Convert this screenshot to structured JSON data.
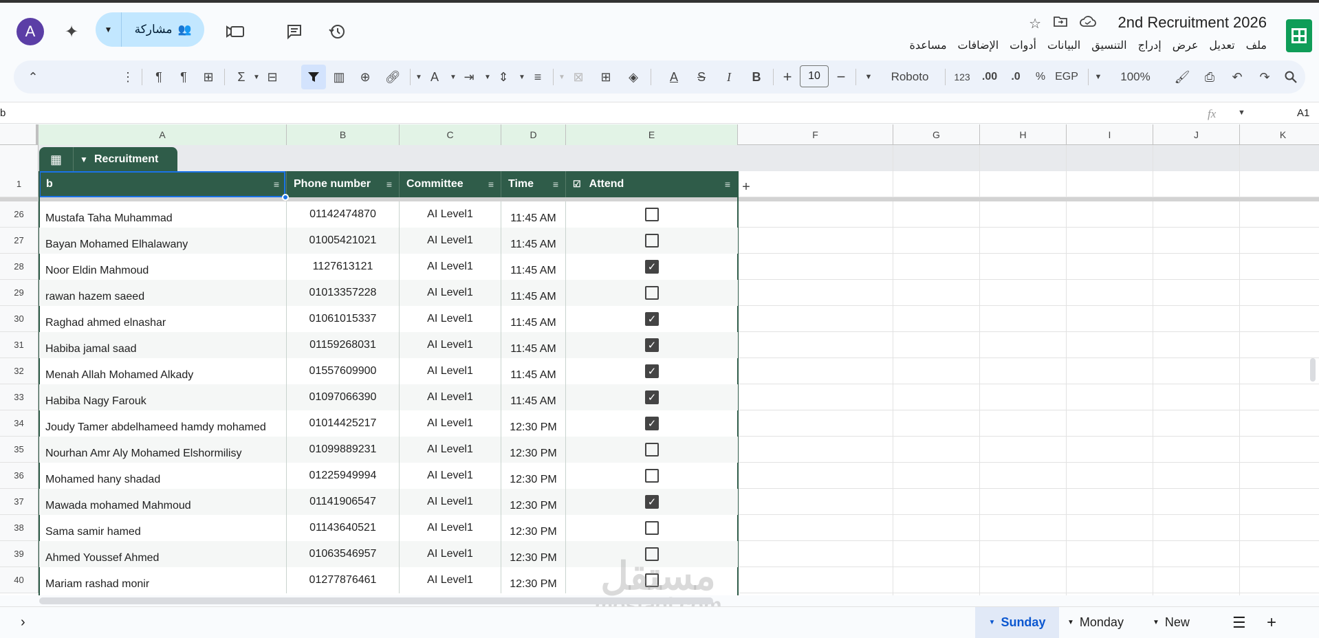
{
  "app": {
    "title": "2nd Recruitment 2026",
    "accent_color": "#2f5c49",
    "account_initial": "A",
    "share_label": "مشاركة"
  },
  "menus": [
    "ملف",
    "تعديل",
    "عرض",
    "إدراج",
    "التنسيق",
    "البيانات",
    "أدوات",
    "الإضافات",
    "مساعدة"
  ],
  "toolbar": {
    "zoom": "100%",
    "currency": "EGP",
    "percent": "%",
    "decrease_decimals": ".0",
    "increase_decimals": ".00",
    "number_format": "123",
    "font": "Roboto",
    "font_size": "10"
  },
  "formula_bar": {
    "cell_ref": "A1",
    "fx": "fx",
    "content": "b"
  },
  "columns": [
    "A",
    "B",
    "C",
    "D",
    "E",
    "F",
    "G",
    "H",
    "I",
    "J",
    "K"
  ],
  "table": {
    "name": "Recruitment",
    "headers": [
      "b",
      "Phone number",
      "Committee",
      "Time",
      "Attend"
    ],
    "header_row_number": "1",
    "rows": [
      {
        "n": "26",
        "name": "Mustafa Taha Muhammad",
        "phone": "01142474870",
        "committee": "AI Level1",
        "time": "11:45 AM",
        "attend": false
      },
      {
        "n": "27",
        "name": "Bayan Mohamed Elhalawany",
        "phone": "01005421021",
        "committee": "AI Level1",
        "time": "11:45 AM",
        "attend": false
      },
      {
        "n": "28",
        "name": "Noor Eldin Mahmoud",
        "phone": "1127613121",
        "committee": "AI Level1",
        "time": "11:45 AM",
        "attend": true
      },
      {
        "n": "29",
        "name": "rawan hazem saeed",
        "phone": "01013357228",
        "committee": "AI Level1",
        "time": "11:45 AM",
        "attend": false
      },
      {
        "n": "30",
        "name": "Raghad ahmed elnashar",
        "phone": "01061015337",
        "committee": "AI Level1",
        "time": "11:45 AM",
        "attend": true
      },
      {
        "n": "31",
        "name": "Habiba jamal saad",
        "phone": "01159268031",
        "committee": "AI Level1",
        "time": "11:45 AM",
        "attend": true
      },
      {
        "n": "32",
        "name": "Menah Allah Mohamed Alkady",
        "phone": "01557609900",
        "committee": "AI Level1",
        "time": "11:45 AM",
        "attend": true
      },
      {
        "n": "33",
        "name": "Habiba Nagy Farouk",
        "phone": "01097066390",
        "committee": "AI Level1",
        "time": "11:45 AM",
        "attend": true
      },
      {
        "n": "34",
        "name": "Joudy Tamer abdelhameed hamdy mohamed",
        "phone": "01014425217",
        "committee": "AI Level1",
        "time": "12:30 PM",
        "attend": true
      },
      {
        "n": "35",
        "name": "Nourhan Amr Aly Mohamed Elshormilisy",
        "phone": "01099889231",
        "committee": "AI Level1",
        "time": "12:30 PM",
        "attend": false
      },
      {
        "n": "36",
        "name": "Mohamed hany shadad",
        "phone": "01225949994",
        "committee": "AI Level1",
        "time": "12:30 PM",
        "attend": false
      },
      {
        "n": "37",
        "name": "Mawada mohamed Mahmoud",
        "phone": "01141906547",
        "committee": "AI Level1",
        "time": "12:30 PM",
        "attend": true
      },
      {
        "n": "38",
        "name": "Sama samir hamed",
        "phone": "01143640521",
        "committee": "AI Level1",
        "time": "12:30 PM",
        "attend": false
      },
      {
        "n": "39",
        "name": "Ahmed Youssef Ahmed",
        "phone": "01063546957",
        "committee": "AI Level1",
        "time": "12:30 PM",
        "attend": false
      },
      {
        "n": "40",
        "name": "Mariam rashad monir",
        "phone": "01277876461",
        "committee": "AI Level1",
        "time": "12:30 PM",
        "attend": false
      }
    ]
  },
  "sheets": [
    "Sunday",
    "Monday",
    "New"
  ],
  "active_sheet": "Sunday",
  "watermark": {
    "line1": "مستقل",
    "line2": "mostaql.com"
  }
}
